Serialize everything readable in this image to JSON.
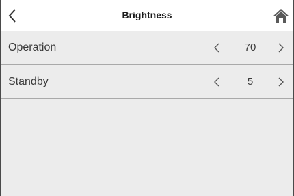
{
  "header": {
    "title": "Brightness",
    "back_icon": "chevron-left-icon",
    "home_icon": "home-icon"
  },
  "settings": [
    {
      "label": "Operation",
      "value": "70"
    },
    {
      "label": "Standby",
      "value": "5"
    }
  ],
  "colors": {
    "background": "#ececec",
    "header_bg": "#ffffff",
    "divider": "#a9a9a9",
    "text": "#3a3a3a",
    "icon": "#555555"
  }
}
